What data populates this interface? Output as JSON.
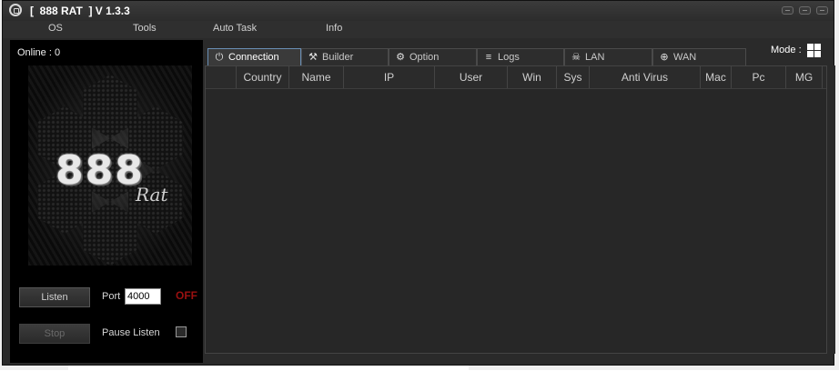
{
  "window": {
    "title": "[  888 RAT  ] V 1.3.3"
  },
  "menu": {
    "items": [
      "OS",
      "Tools",
      "Auto Task",
      "Info"
    ]
  },
  "left_panel": {
    "online_label": "Online : 0",
    "logo_main": "888",
    "logo_sub": "Rat",
    "listen_label": "Listen",
    "stop_label": "Stop",
    "port_label": "Port",
    "port_value": "4000",
    "status_label": "OFF",
    "pause_listen_label": "Pause Listen",
    "pause_listen_checked": false
  },
  "mode": {
    "label": "Mode :",
    "icon": "windows-icon"
  },
  "tabs": [
    {
      "label": "Connection",
      "icon": "plug-icon",
      "active": true
    },
    {
      "label": "Builder",
      "icon": "tools-icon",
      "active": false
    },
    {
      "label": "Option",
      "icon": "gear-icon",
      "active": false
    },
    {
      "label": "Logs",
      "icon": "list-icon",
      "active": false
    },
    {
      "label": "LAN",
      "icon": "skull-icon",
      "active": false
    },
    {
      "label": "WAN",
      "icon": "globe-icon",
      "active": false
    }
  ],
  "table": {
    "columns": [
      "",
      "Country",
      "Name",
      "IP",
      "User",
      "Win",
      "Sys",
      "Anti Virus",
      "Mac",
      "Pc",
      "MG"
    ],
    "rows": []
  },
  "colors": {
    "window_bg": "#2a2a2a",
    "left_panel_bg": "#000000",
    "off_status": "#9b1010",
    "active_tab_border": "#6a8fb5"
  }
}
